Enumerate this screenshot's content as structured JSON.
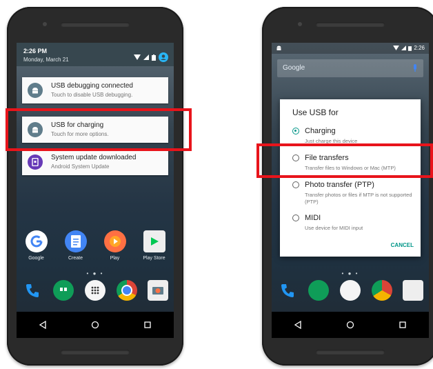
{
  "left_phone": {
    "shade": {
      "time": "2:26 PM",
      "date": "Monday, March 21"
    },
    "notifications": [
      {
        "title": "USB debugging connected",
        "subtitle": "Touch to disable USB debugging.",
        "icon": "android-icon",
        "icon_color": "#607d8b"
      },
      {
        "title": "USB for charging",
        "subtitle": "Touch for more options.",
        "icon": "android-icon",
        "icon_color": "#607d8b"
      },
      {
        "title": "System update downloaded",
        "subtitle": "Android System Update",
        "icon": "system-update-icon",
        "icon_color": "#673ab7"
      }
    ],
    "apps": [
      {
        "label": "Google",
        "icon": "google-icon",
        "color": "#ffffff"
      },
      {
        "label": "Create",
        "icon": "create-doc-icon",
        "color": "#4285f4"
      },
      {
        "label": "Play",
        "icon": "play-music-icon",
        "color": "#ff7043"
      },
      {
        "label": "Play Store",
        "icon": "play-store-icon",
        "color": "#eeeeee"
      }
    ],
    "dock": [
      "phone-icon",
      "hangouts-icon",
      "app-drawer-icon",
      "chrome-icon",
      "camera-icon"
    ]
  },
  "right_phone": {
    "status_time": "2:26",
    "search_brand": "Google",
    "dialog": {
      "title": "Use USB for",
      "options": [
        {
          "label": "Charging",
          "description": "Just charge this device",
          "selected": true
        },
        {
          "label": "File transfers",
          "description": "Transfer files to Windows or Mac (MTP)",
          "selected": false
        },
        {
          "label": "Photo transfer (PTP)",
          "description": "Transfer photos or files if MTP is not supported (PTP)",
          "selected": false
        },
        {
          "label": "MIDI",
          "description": "Use device for MIDI input",
          "selected": false
        }
      ],
      "cancel_label": "CANCEL"
    }
  },
  "colors": {
    "highlight": "#e8141b",
    "accent": "#009688"
  }
}
